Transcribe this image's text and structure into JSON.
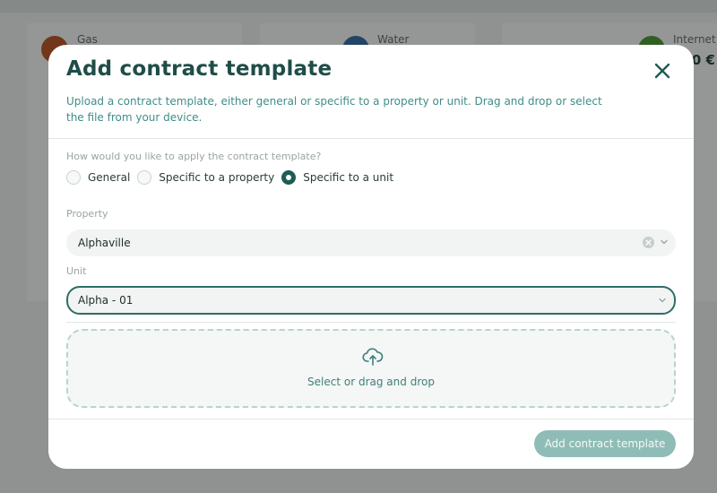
{
  "background": {
    "cards": [
      {
        "label": "Gas",
        "color": "#c0501f"
      },
      {
        "label": "Water",
        "color": "#2f6aa8"
      },
      {
        "label": "Internet",
        "color": "#4a9a2f",
        "amount": "0 €"
      }
    ],
    "bar_colors": [
      "#2f5f8a",
      "#8a8a1f",
      "#a8502f",
      "#3f8a2f"
    ]
  },
  "modal": {
    "title": "Add contract template",
    "description": "Upload a contract template, either general or specific to a property or unit. Drag and drop or select the file from your device.",
    "question": "How would you like to apply the contract template?",
    "radio_options": [
      {
        "label": "General",
        "selected": false
      },
      {
        "label": "Specific to a property",
        "selected": false
      },
      {
        "label": "Specific to a unit",
        "selected": true
      }
    ],
    "property_label": "Property",
    "property_value": "Alphaville",
    "unit_label": "Unit",
    "unit_value": "Alpha - 01",
    "dropzone_text": "Select or drag and drop",
    "submit_label": "Add contract template"
  },
  "icons": {
    "close": "close-icon",
    "clear": "clear-icon",
    "chevron": "chevron-down-icon",
    "upload": "cloud-upload-icon"
  },
  "colors": {
    "accent": "#1f5c56",
    "title": "#1f4d48",
    "description": "#3f8d87",
    "submit_disabled": "#8fbcb7"
  }
}
